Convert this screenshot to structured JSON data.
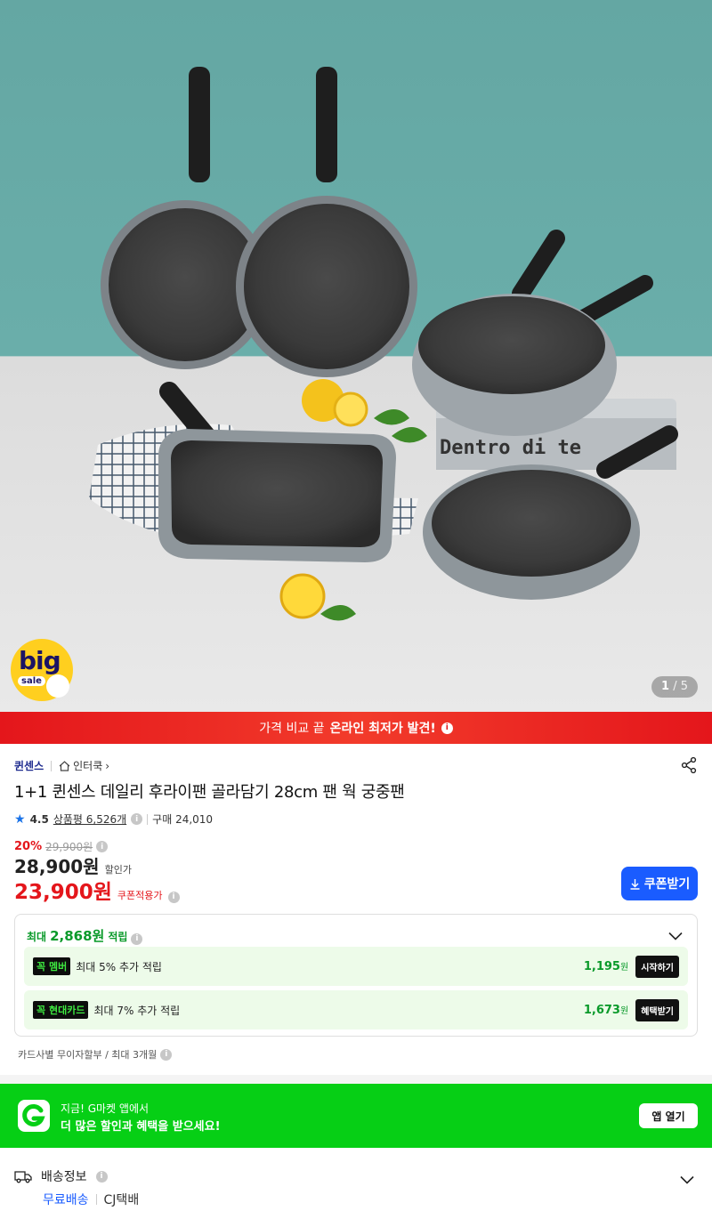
{
  "gallery": {
    "image_alt": "Dentro dite cookware set product photo",
    "book_text": "Dentro di te",
    "counter_current": "1",
    "counter_sep": "/",
    "counter_total": "5",
    "badge_big": "big",
    "badge_sale": "sale"
  },
  "price_banner": {
    "prefix": "가격 비교 끝",
    "highlight": "온라인 최저가 발견!",
    "info_icon": "info-icon"
  },
  "product": {
    "brand": "퀸센스",
    "store": "인터쿡",
    "store_chevron": "›",
    "title": "1+1 퀸센스 데일리 후라이팬 골라담기 28cm 팬 웍 궁중팬",
    "rating": "4.5",
    "reviews": "상품평 6,526개",
    "purchases": "구매 24,010",
    "discount_pct": "20%",
    "original_price": "29,900원",
    "sale_price": "28,900원",
    "sale_label": "할인가",
    "coupon_price": "23,900원",
    "coupon_label": "쿠폰적용가",
    "coupon_button": "쿠폰받기"
  },
  "points": {
    "prefix": "최대",
    "amount": "2,868원",
    "suffix": "적립",
    "benefits": [
      {
        "tag_k": "꼭",
        "tag": "멤버",
        "desc": "최대 5% 추가 적립",
        "points": "1,195",
        "unit": "원",
        "action": "시작하기"
      },
      {
        "tag_k": "꼭",
        "tag": "현대카드",
        "desc": "최대 7% 추가 적립",
        "points": "1,673",
        "unit": "원",
        "action": "혜택받기"
      }
    ],
    "installment": "카드사별 무이자할부 / 최대 3개월"
  },
  "app_banner": {
    "line1": "지금! G마켓 앱에서",
    "line2": "더 많은 할인과 혜택을 받으세요!",
    "button": "앱 열기",
    "logo_letter": "G"
  },
  "shipping": {
    "title": "배송정보",
    "free": "무료배송",
    "carrier": "CJ택배"
  },
  "colors": {
    "accent_red": "#e4161b",
    "brand_blue": "#1a5cff",
    "gmarket_green": "#06cf15",
    "points_green": "#0a9a2a"
  }
}
